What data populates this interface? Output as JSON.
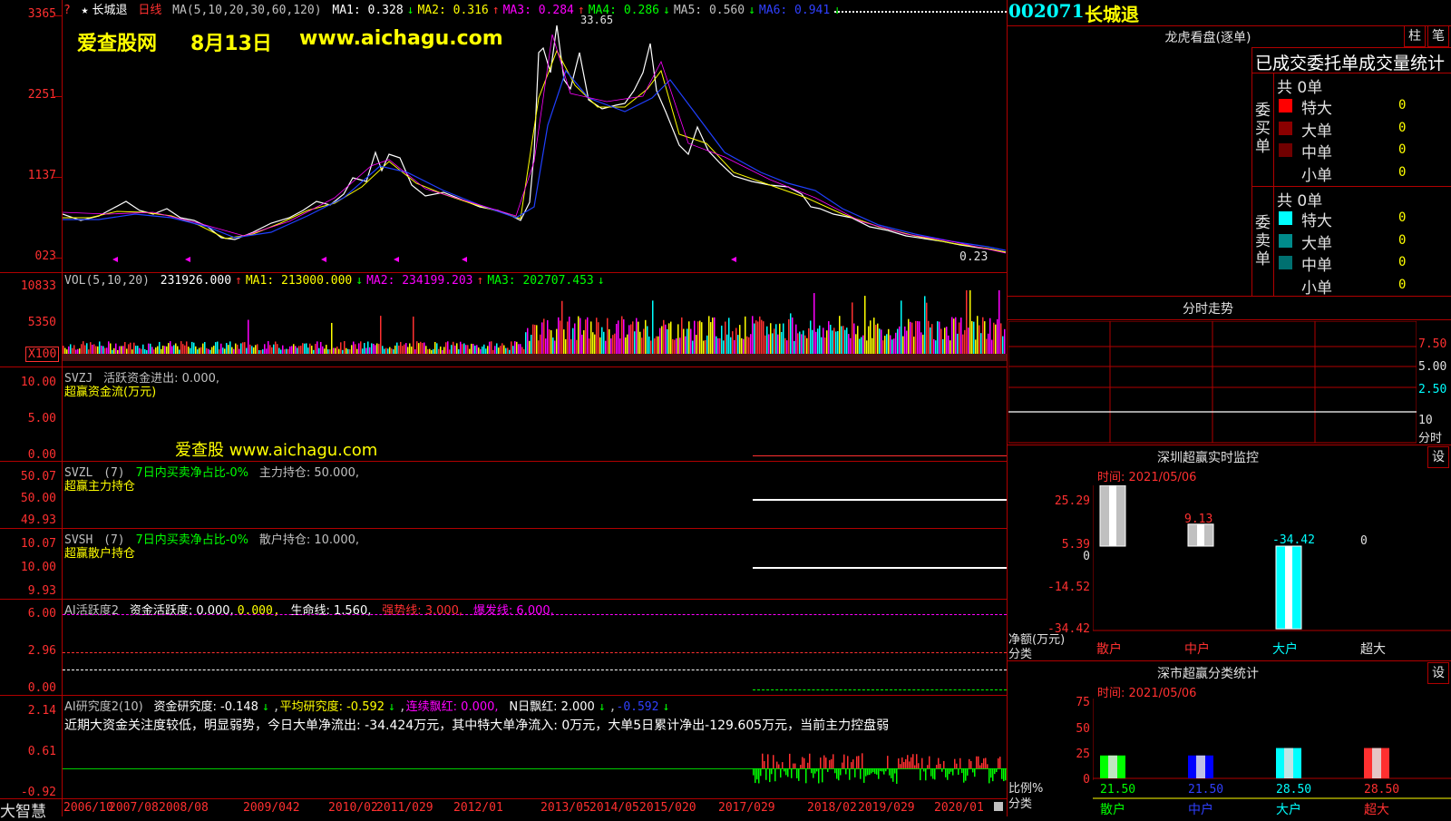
{
  "header": {
    "stock_name": "长城退",
    "period": "日线",
    "ma_params": "MA(5,10,20,30,60,120)",
    "ma1": "MA1: 0.328",
    "ma2": "MA2: 0.316",
    "ma3": "MA3: 0.284",
    "ma4": "MA4: 0.286",
    "ma5": "MA5: 0.560",
    "ma6": "MA6: 0.941",
    "watermark_site": "爱查股网",
    "watermark_date": "8月13日",
    "watermark_url": "www.aichagu.com",
    "high_marker": "33.65",
    "low_marker": "0.23",
    "arrow_down": "↓",
    "arrow_up": "↑"
  },
  "price_axis": [
    "3365",
    "2251",
    "1137",
    "023"
  ],
  "volume": {
    "header_params": "VOL(5,10,20)",
    "value": "231926.000",
    "ma1": "MA1: 213000.000",
    "ma2": "MA2: 234199.203",
    "ma3": "MA3: 202707.453",
    "axis": [
      "10833",
      "5350",
      "X100"
    ]
  },
  "svzj": {
    "name": "SVZJ",
    "label": "活跃资金进出: 0.000,",
    "subtitle": "超赢资金流(万元)",
    "watermark": "爱查股 www.aichagu.com",
    "axis": [
      "10.00",
      "5.00",
      "0.00"
    ]
  },
  "svzl": {
    "name": "SVZL",
    "param": "(7)",
    "desc": "7日内买卖净占比-0%",
    "label": "主力持仓: 50.000,",
    "subtitle": "超赢主力持仓",
    "axis": [
      "50.07",
      "50.00",
      "49.93"
    ]
  },
  "svsh": {
    "name": "SVSH",
    "param": "(7)",
    "desc": "7日内买卖净占比-0%",
    "label": "散户持仓: 10.000,",
    "subtitle": "超赢散户持仓",
    "axis": [
      "10.07",
      "10.00",
      "9.93"
    ]
  },
  "ai_active": {
    "name": "AI活跃度2",
    "v1": "资金活跃度: 0.000,",
    "v2": "0.000,",
    "v3": "生命线: 1.560,",
    "v4": "强势线: 3.000,",
    "v5": "爆发线: 6.000,",
    "axis": [
      "6.00",
      "2.96",
      "0.00"
    ]
  },
  "ai_research": {
    "name": "AI研究度2(10)",
    "v1": "资金研究度: -0.148",
    "v2": "平均研究度: -0.592",
    "v3": "连续飘红: 0.000,",
    "v4": "N日飘红: 2.000",
    "v5": "-0.592",
    "comment": "近期大资金关注度较低，明显弱势，今日大单净流出: -34.424万元，其中特大单净流入: 0万元，大单5日累计净出-129.605万元，当前主力控盘弱",
    "axis": [
      "2.14",
      "0.61",
      "-0.92"
    ]
  },
  "dates": [
    "2006/10",
    "2007/08",
    "2008/08",
    "2009/042",
    "2010/02",
    "2011/029",
    "2012/01",
    "2013/05",
    "2014/05",
    "2015/020",
    "2017/029",
    "2018/02",
    "2019/029",
    "2020/01"
  ],
  "bottom_brand": "大智慧",
  "right": {
    "code": "002071",
    "name": "长城退",
    "lhb_title": "龙虎看盘(逐单)",
    "tab1": "柱",
    "tab2": "笔",
    "lhb_subtitle": "已成交委托单成交量统计",
    "buy_total": "共 0单",
    "buy_label": "委买单",
    "sell_total": "共 0单",
    "sell_label": "委卖单",
    "buy_rows": [
      {
        "label": "特大",
        "value": "0",
        "color": "#ff0000"
      },
      {
        "label": "大单",
        "value": "0",
        "color": "#8b0000"
      },
      {
        "label": "中单",
        "value": "0",
        "color": "#700000"
      },
      {
        "label": "小单",
        "value": "0",
        "color": "#000000"
      }
    ],
    "sell_rows": [
      {
        "label": "特大",
        "value": "0",
        "color": "#00ffff"
      },
      {
        "label": "大单",
        "value": "0",
        "color": "#008b8b"
      },
      {
        "label": "中单",
        "value": "0",
        "color": "#007070"
      },
      {
        "label": "小单",
        "value": "0",
        "color": "#000000"
      }
    ],
    "intraday_title": "分时走势",
    "intraday_axis": [
      "7.50",
      "5.00",
      "2.50",
      "10",
      "分时"
    ],
    "sz_monitor_title": "深圳超赢实时监控",
    "sz_set": "设",
    "sz_time": "时间: 2021/05/06",
    "sz_axis": [
      "25.29",
      "5.39",
      "0",
      "-14.52",
      "-34.42"
    ],
    "sz_unit": "净额(万元)",
    "sz_cat": "分类",
    "sz_bars": [
      {
        "name": "散户",
        "value": 25.29,
        "label": "25.29"
      },
      {
        "name": "中户",
        "value": 9.13,
        "label": "9.13"
      },
      {
        "name": "大户",
        "value": -34.42,
        "label": "-34.42"
      },
      {
        "name": "超大",
        "value": 0,
        "label": "0"
      }
    ],
    "class_title": "深市超赢分类统计",
    "class_set": "设",
    "class_time": "时间: 2021/05/06",
    "class_axis": [
      "75",
      "50",
      "25",
      "0"
    ],
    "class_unit": "比例%",
    "class_cat": "分类",
    "class_bars": [
      {
        "name": "散户",
        "value": 21.5,
        "label": "21.50",
        "color": "#00ff00"
      },
      {
        "name": "中户",
        "value": 21.5,
        "label": "21.50",
        "color": "#0000ff"
      },
      {
        "name": "大户",
        "value": 28.5,
        "label": "28.50",
        "color": "#00ffff"
      },
      {
        "name": "超大",
        "value": 28.5,
        "label": "28.50",
        "color": "#ff3030"
      }
    ]
  }
}
